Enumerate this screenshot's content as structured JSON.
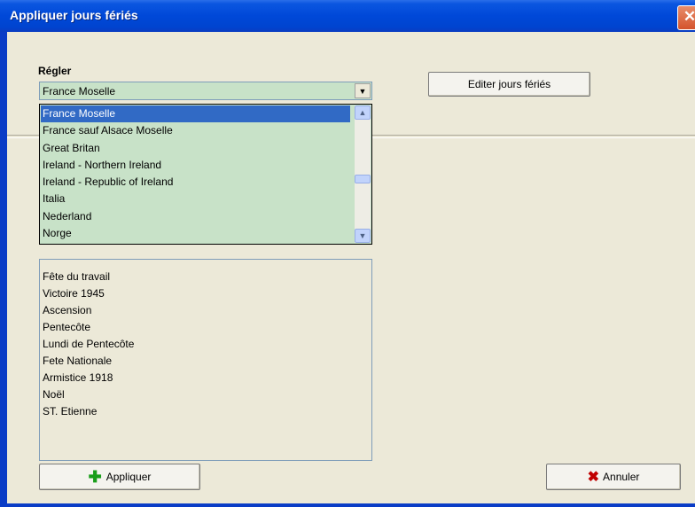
{
  "window": {
    "title": "Appliquer jours fériés",
    "close_glyph": "✕"
  },
  "form": {
    "label": "Régler",
    "combo_value": "France Moselle",
    "combo_arrow": "▼",
    "dropdown": {
      "items": [
        "France Moselle",
        "France sauf Alsace Moselle",
        "Great Britan",
        "Ireland - Northern Ireland",
        "Ireland - Republic of Ireland",
        "Italia",
        "Nederland",
        "Norge"
      ],
      "selected_index": 0,
      "scroll_up": "▲",
      "scroll_down": "▼"
    },
    "edit_button": "Editer jours fériés"
  },
  "holidays": [
    "Fête du travail",
    "Victoire 1945",
    "Ascension",
    "Pentecôte",
    "Lundi de Pentecôte",
    "Fete Nationale",
    "Armistice 1918",
    "Noël",
    "ST. Etienne"
  ],
  "buttons": {
    "apply": "Appliquer",
    "apply_icon": "plus-icon",
    "cancel": "Annuler",
    "cancel_icon": "x-icon"
  }
}
